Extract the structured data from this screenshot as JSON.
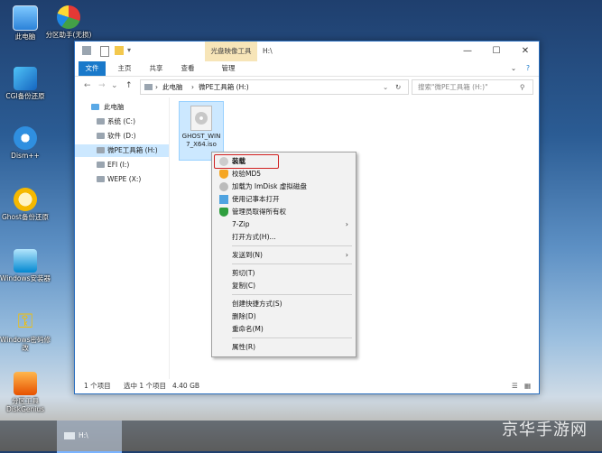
{
  "desktop": {
    "icons": [
      {
        "label": "此电脑",
        "icon": "computer-icon"
      },
      {
        "label": "分区助手(无损)",
        "icon": "partition-assistant-icon"
      },
      {
        "label": "CGI备份还原",
        "icon": "cgi-backup-icon"
      },
      {
        "label": "Dism++",
        "icon": "dism-gear-icon"
      },
      {
        "label": "Ghost备份还原",
        "icon": "ghost-icon"
      },
      {
        "label": "Windows安装器",
        "icon": "windows-installer-icon"
      },
      {
        "label": "Windows密码修改",
        "icon": "key-icon"
      },
      {
        "label": "分区工具DiskGenius",
        "icon": "diskgenius-icon"
      }
    ]
  },
  "window": {
    "context_tab": "光盘映像工具",
    "title": "H:\\",
    "controls": {
      "minimize": "—",
      "maximize": "☐",
      "close": "✕"
    },
    "ribbon_tabs": [
      "文件",
      "主页",
      "共享",
      "查看",
      "管理"
    ],
    "address": {
      "crumbs": [
        "此电脑",
        "微PE工具箱 (H:)"
      ],
      "search_placeholder": "搜索\"微PE工具箱 (H:)\""
    },
    "nav": [
      {
        "label": "此电脑",
        "selected": false
      },
      {
        "label": "系统 (C:)",
        "selected": false
      },
      {
        "label": "软件 (D:)",
        "selected": false
      },
      {
        "label": "微PE工具箱 (H:)",
        "selected": true
      },
      {
        "label": "EFI (I:)",
        "selected": false
      },
      {
        "label": "WEPE (X:)",
        "selected": false
      }
    ],
    "file": {
      "name": "GHOST_WIN7_X64.iso"
    },
    "status": {
      "count": "1 个项目",
      "selected": "选中 1 个项目",
      "size": "4.40 GB"
    }
  },
  "context_menu": {
    "items": [
      {
        "label": "装载",
        "bold": true,
        "icon": "disc-icon"
      },
      {
        "label": "校验MD5",
        "icon": "shield-icon"
      },
      {
        "label": "加载为 ImDisk 虚拟磁盘",
        "icon": "disc-icon"
      },
      {
        "label": "使用记事本打开",
        "icon": "notepad-icon"
      },
      {
        "label": "管理员取得所有权",
        "icon": "shield-green-icon"
      },
      {
        "label": "7-Zip",
        "submenu": true
      },
      {
        "label": "打开方式(H)..."
      },
      {
        "label": "发送到(N)",
        "submenu": true
      },
      {
        "label": "剪切(T)"
      },
      {
        "label": "复制(C)"
      },
      {
        "label": "创建快捷方式(S)"
      },
      {
        "label": "删除(D)"
      },
      {
        "label": "重命名(M)"
      },
      {
        "label": "属性(R)"
      }
    ]
  },
  "taskbar": {
    "active_window": "H:\\"
  },
  "watermark": "京华手游网",
  "colors": {
    "accent": "#1979ca",
    "selection": "#cce8ff",
    "highlight_box": "#d02020",
    "context_tab": "#f7e5b8"
  }
}
